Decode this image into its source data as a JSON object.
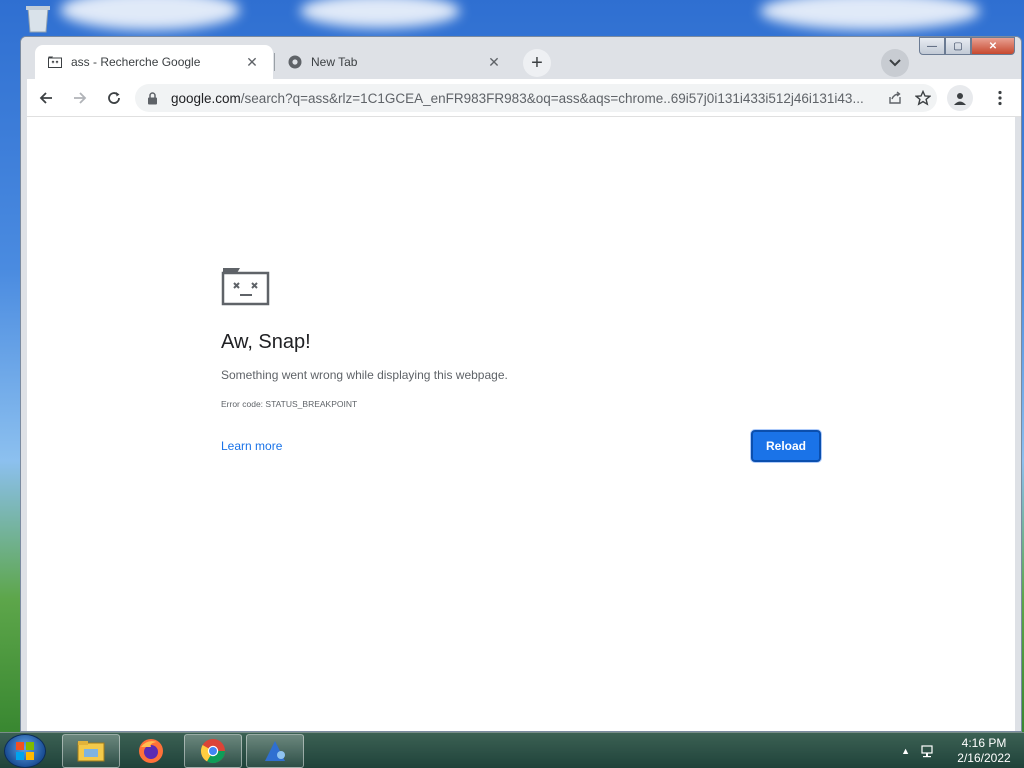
{
  "tabs": [
    {
      "label": "ass - Recherche Google",
      "active": true
    },
    {
      "label": "New Tab",
      "active": false
    }
  ],
  "omnibox": {
    "domain": "google.com",
    "path": "/search?q=ass&rlz=1C1GCEA_enFR983FR983&oq=ass&aqs=chrome..69i57j0i131i433i512j46i131i43..."
  },
  "error_page": {
    "title": "Aw, Snap!",
    "message": "Something went wrong while displaying this webpage.",
    "error_code": "Error code: STATUS_BREAKPOINT",
    "learn_more": "Learn more",
    "reload": "Reload"
  },
  "window_controls": {
    "close": "✕",
    "maximize": "▢",
    "minimize": "—"
  },
  "taskbar": {
    "apps": [
      "windows-explorer",
      "firefox",
      "chrome",
      "app"
    ],
    "time": "4:16 PM",
    "date": "2/16/2022"
  },
  "colors": {
    "accent": "#1a73e8",
    "tabstrip": "#dee1e6",
    "text": "#202124"
  }
}
